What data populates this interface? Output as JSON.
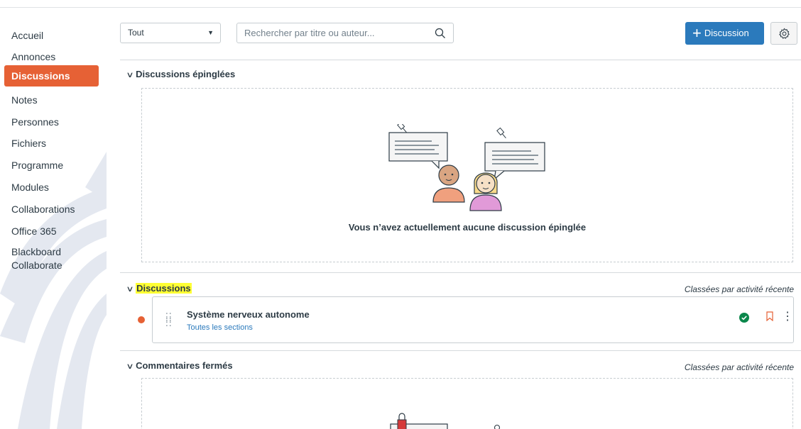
{
  "sidebar": {
    "items": [
      {
        "label": "Accueil",
        "active": false
      },
      {
        "label": "Annonces",
        "active": false
      },
      {
        "label": "Discussions",
        "active": true
      },
      {
        "label": "Notes",
        "active": false
      },
      {
        "label": "Personnes",
        "active": false
      },
      {
        "label": "Fichiers",
        "active": false
      },
      {
        "label": "Programme",
        "active": false
      },
      {
        "label": "Modules",
        "active": false
      },
      {
        "label": "Collaborations",
        "active": false
      },
      {
        "label": "Office 365",
        "active": false
      },
      {
        "label": "Blackboard Collaborate",
        "active": false
      }
    ]
  },
  "toolbar": {
    "filter_value": "Tout",
    "search_placeholder": "Rechercher par titre ou auteur...",
    "new_button_label": "Discussion"
  },
  "pinned": {
    "title": "Discussions épinglées",
    "empty_message": "Vous n’avez actuellement aucune discussion épinglée"
  },
  "discussions": {
    "title": "Discussions",
    "sort_note": "Classées par activité récente",
    "items": [
      {
        "title": "Système nerveux autonome",
        "subtitle": "Toutes les sections",
        "unread": true,
        "published": true
      }
    ]
  },
  "closed": {
    "title": "Commentaires fermés",
    "sort_note": "Classées par activité récente"
  },
  "colors": {
    "accent_orange": "#e66135",
    "primary_blue": "#2b7abc",
    "published_green": "#0b874b",
    "highlight_yellow": "#ffff33"
  }
}
